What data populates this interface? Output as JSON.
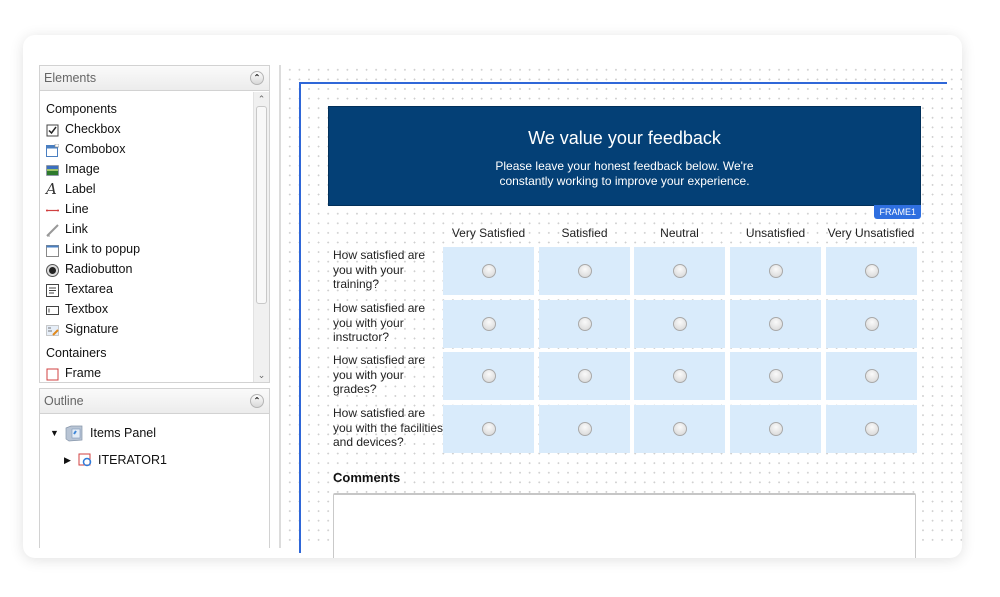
{
  "elements_panel": {
    "title": "Elements",
    "collapse_icon": "chevron-up-circle-icon",
    "sections": [
      {
        "title": "Components",
        "items": [
          {
            "label": "Checkbox",
            "icon": "checkbox-icon"
          },
          {
            "label": "Combobox",
            "icon": "combobox-icon"
          },
          {
            "label": "Image",
            "icon": "image-icon"
          },
          {
            "label": "Label",
            "icon": "label-icon"
          },
          {
            "label": "Line",
            "icon": "line-icon"
          },
          {
            "label": "Link",
            "icon": "link-icon"
          },
          {
            "label": "Link to popup",
            "icon": "link-popup-icon"
          },
          {
            "label": "Radiobutton",
            "icon": "radiobutton-icon"
          },
          {
            "label": "Textarea",
            "icon": "textarea-icon"
          },
          {
            "label": "Textbox",
            "icon": "textbox-icon"
          },
          {
            "label": "Signature",
            "icon": "signature-icon"
          }
        ]
      },
      {
        "title": "Containers",
        "items": [
          {
            "label": "Frame",
            "icon": "frame-icon"
          }
        ]
      }
    ]
  },
  "outline_panel": {
    "title": "Outline",
    "tree": [
      {
        "label": "Items Panel",
        "expanded": true,
        "icon": "items-panel-icon"
      },
      {
        "label": "ITERATOR1",
        "expanded": false,
        "icon": "iterator-icon"
      }
    ]
  },
  "form": {
    "header": {
      "title": "We value your feedback",
      "subtitle_line1": "Please leave your honest feedback below. We're",
      "subtitle_line2": "constantly working to improve your experience.",
      "badge": "FRAME1",
      "background": "#044076"
    },
    "columns": [
      "Very Satisfied",
      "Satisfied",
      "Neutral",
      "Unsatisfied",
      "Very Unsatisfied"
    ],
    "questions": [
      {
        "line1": "How satisfied are",
        "line2": "you with your",
        "line3": "training?"
      },
      {
        "line1": "How satisfied are",
        "line2": "you with your",
        "line3": "instructor?"
      },
      {
        "line1": "How satisfied are",
        "line2": "you with your",
        "line3": "grades?"
      },
      {
        "line1": "How satisfied are",
        "line2": "you with the facilities",
        "line3": "and devices?"
      }
    ],
    "comments_label": "Comments",
    "comments_value": "",
    "accent": "#2f67d8",
    "cell_color": "#d9ebfb"
  }
}
